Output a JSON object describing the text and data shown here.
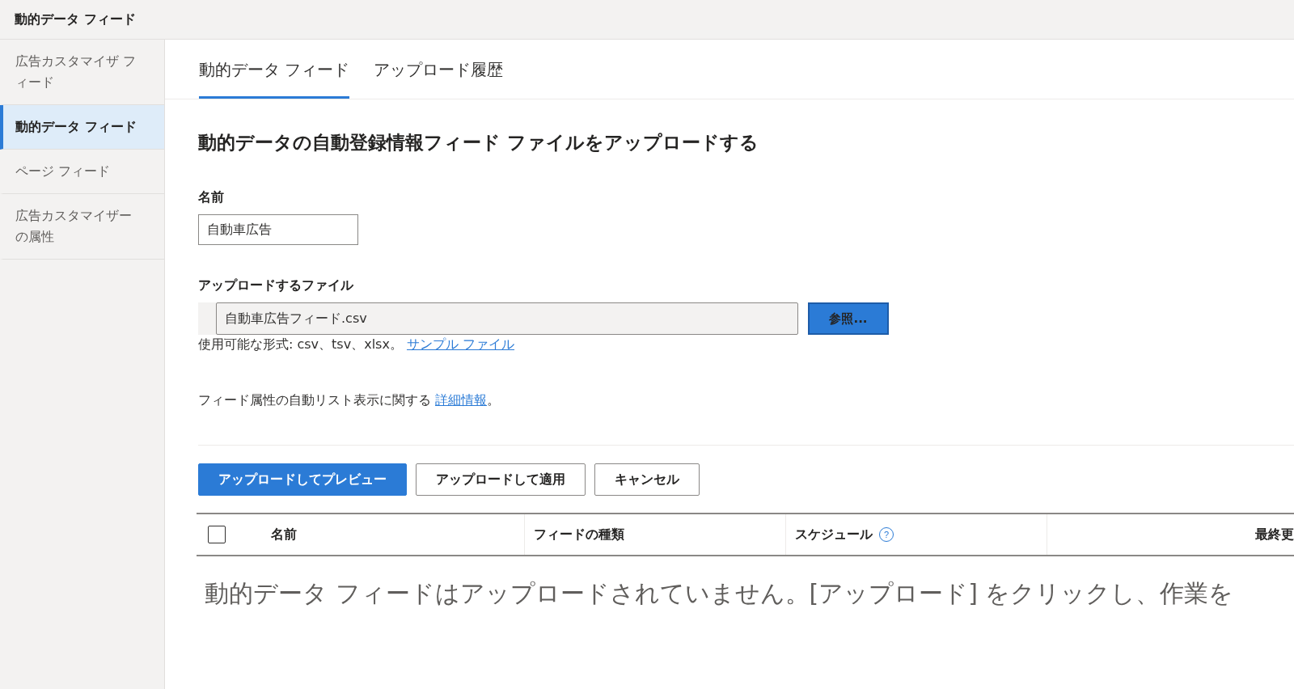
{
  "header": {
    "title": "動的データ フィード"
  },
  "sidebar": {
    "items": [
      {
        "label": "広告カスタマイザ フィード",
        "selected": false
      },
      {
        "label": "動的データ フィード",
        "selected": true
      },
      {
        "label": "ページ フィード",
        "selected": false
      },
      {
        "label": "広告カスタマイザーの属性",
        "selected": false
      }
    ]
  },
  "tabs": [
    {
      "label": "動的データ フィード",
      "selected": true
    },
    {
      "label": "アップロード履歴",
      "selected": false
    }
  ],
  "form": {
    "heading": "動的データの自動登録情報フィード ファイルをアップロードする",
    "name_label": "名前",
    "name_value": "自動車広告",
    "file_label": "アップロードするファイル",
    "file_value": "自動車広告フィード.csv",
    "browse_button": "参照...",
    "formats_text": "使用可能な形式: csv、tsv、xlsx。",
    "sample_link": "サンプル ファイル",
    "info_text": "フィード属性の自動リスト表示に関する",
    "info_link": "詳細情報",
    "info_end": "。"
  },
  "buttons": [
    {
      "label": "アップロードしてプレビュー",
      "kind": "primary"
    },
    {
      "label": "アップロードして適用",
      "kind": "secondary"
    },
    {
      "label": "キャンセル",
      "kind": "secondary"
    }
  ],
  "table": {
    "select_all_checked": false,
    "columns": [
      {
        "label": "名前"
      },
      {
        "label": "フィードの種類"
      },
      {
        "label": "スケジュール",
        "help_icon": "?"
      },
      {
        "label": "最終更"
      }
    ],
    "empty_text": "動的データ フィードはアップロードされていません。[アップロード] をクリックし、作業を"
  }
}
